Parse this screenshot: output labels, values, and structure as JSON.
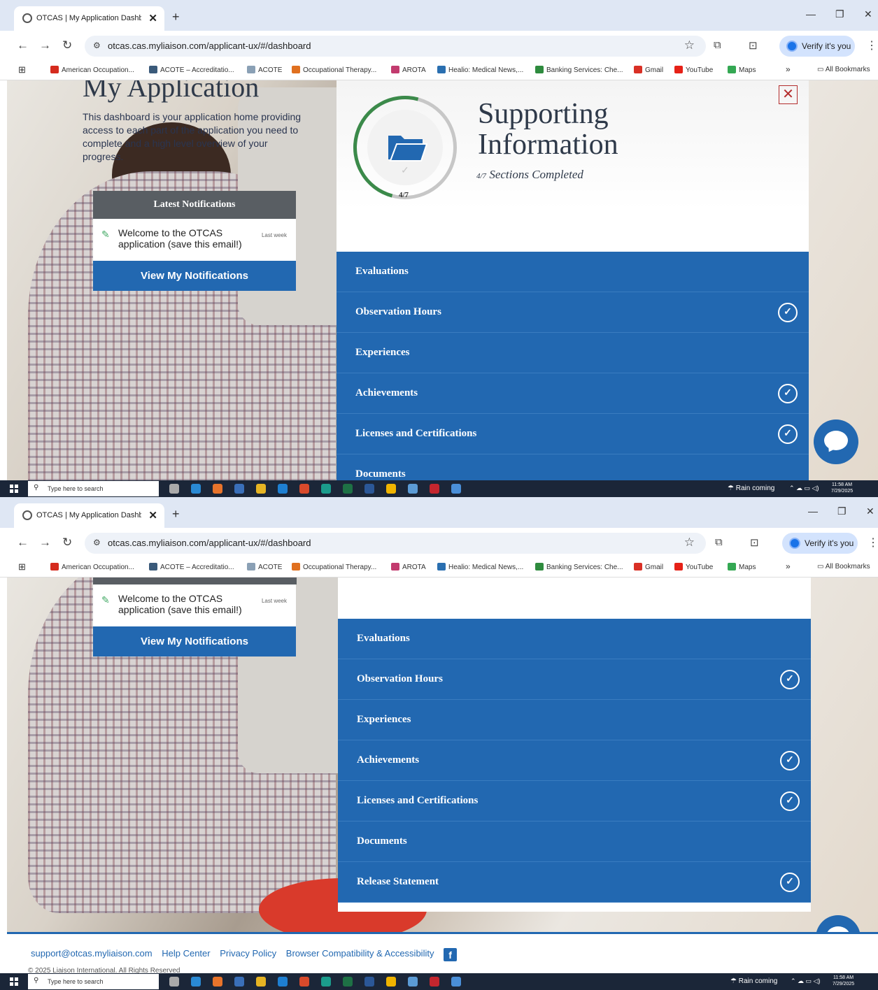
{
  "browser": {
    "tab_title": "OTCAS | My Application Dashboard",
    "tab_close": "✕",
    "new_tab": "+",
    "url": "otcas.cas.myliaison.com/applicant-ux/#/dashboard",
    "verify_label": "Verify it's you",
    "bookmarks": [
      {
        "label": "American Occupation...",
        "color": "#d52b1e"
      },
      {
        "label": "ACOTE – Accreditatio...",
        "color": "#3a5a7a"
      },
      {
        "label": "ACOTE",
        "color": "#8aa0b5"
      },
      {
        "label": "Occupational Therapy...",
        "color": "#e0701f"
      },
      {
        "label": "AROTA",
        "color": "#c23b6e"
      },
      {
        "label": "Healio: Medical News,...",
        "color": "#2a6fb0"
      },
      {
        "label": "Banking Services: Che...",
        "color": "#2e8b3e"
      },
      {
        "label": "Gmail",
        "color": "#d93025"
      },
      {
        "label": "YouTube",
        "color": "#e62117"
      },
      {
        "label": "Maps",
        "color": "#34a853"
      }
    ],
    "all_bookmarks": "All Bookmarks",
    "more_bookmarks": "»"
  },
  "intro": {
    "title": "My Application",
    "description": "This dashboard is your application home providing access to each part of the application you need to complete and a high level overview of your progress."
  },
  "notifications": {
    "header": "Latest Notifications",
    "item_text": "Welcome to the OTCAS application (save this email!)",
    "item_time": "Last week",
    "button": "View My Notifications"
  },
  "panel": {
    "title_line1": "Supporting",
    "title_line2": "Information",
    "progress": "4/7",
    "progress_fraction": 0.571,
    "sections_text": "Sections Completed",
    "close": "✕"
  },
  "sections": [
    {
      "label": "Evaluations",
      "completed": false
    },
    {
      "label": "Observation Hours",
      "completed": true
    },
    {
      "label": "Experiences",
      "completed": false
    },
    {
      "label": "Achievements",
      "completed": true
    },
    {
      "label": "Licenses and Certifications",
      "completed": true
    },
    {
      "label": "Documents",
      "completed": false
    },
    {
      "label": "Release Statement",
      "completed": true
    }
  ],
  "footer": {
    "links": [
      "support@otcas.myliaison.com",
      "Help Center",
      "Privacy Policy",
      "Browser Compatibility & Accessibility"
    ],
    "facebook": "f",
    "copyright": "© 2025 Liaison International. All Rights Reserved"
  },
  "taskbar": {
    "search_placeholder": "Type here to search",
    "weather": "Rain coming",
    "time": "11:58 AM",
    "date": "7/29/2025"
  },
  "icons": {
    "check": "✓",
    "close": "✕"
  }
}
